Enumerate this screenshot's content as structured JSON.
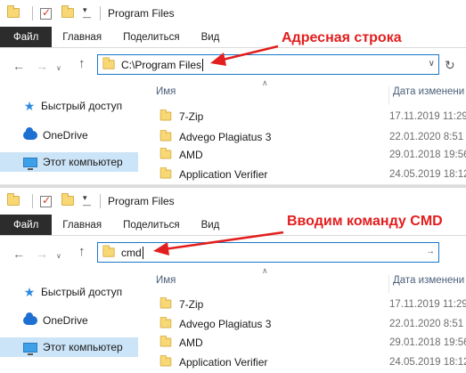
{
  "window_title": "Program Files",
  "ribbon_tabs": [
    "Файл",
    "Главная",
    "Поделиться",
    "Вид"
  ],
  "panels": [
    {
      "address_value": "C:\\Program Files",
      "annotation": "Адресная строка"
    },
    {
      "address_value": "cmd",
      "annotation": "Вводим команду CMD"
    }
  ],
  "nav": {
    "quick_access": "Быстрый доступ",
    "onedrive": "OneDrive",
    "this_pc": "Этот компьютер"
  },
  "columns": {
    "name": "Имя",
    "date": "Дата изменени"
  },
  "files": [
    {
      "name": "7-Zip",
      "date": "17.11.2019 11:29"
    },
    {
      "name": "Advego Plagiatus 3",
      "date": "22.01.2020 8:51"
    },
    {
      "name": "AMD",
      "date": "29.01.2018 19:56"
    },
    {
      "name": "Application Verifier",
      "date": "24.05.2019 18:12"
    }
  ],
  "icons": {
    "quick_access_folder": "folder-icon",
    "quick_access_properties": "properties-icon",
    "quick_access_new_folder": "new-folder-icon",
    "qa_customize": "chevron-down-icon",
    "back": "arrow-left-icon",
    "forward": "arrow-right-icon",
    "recent": "chevron-down-icon",
    "up": "arrow-up-icon",
    "refresh": "refresh-icon",
    "quick_access_nav": "star-icon",
    "onedrive_nav": "cloud-icon",
    "this_pc_nav": "computer-icon"
  },
  "colors": {
    "address_border": "#1979ca",
    "selected_nav": "#cce4f7",
    "annotation": "#e31e1e",
    "file_tab": "#2c2c2c"
  }
}
